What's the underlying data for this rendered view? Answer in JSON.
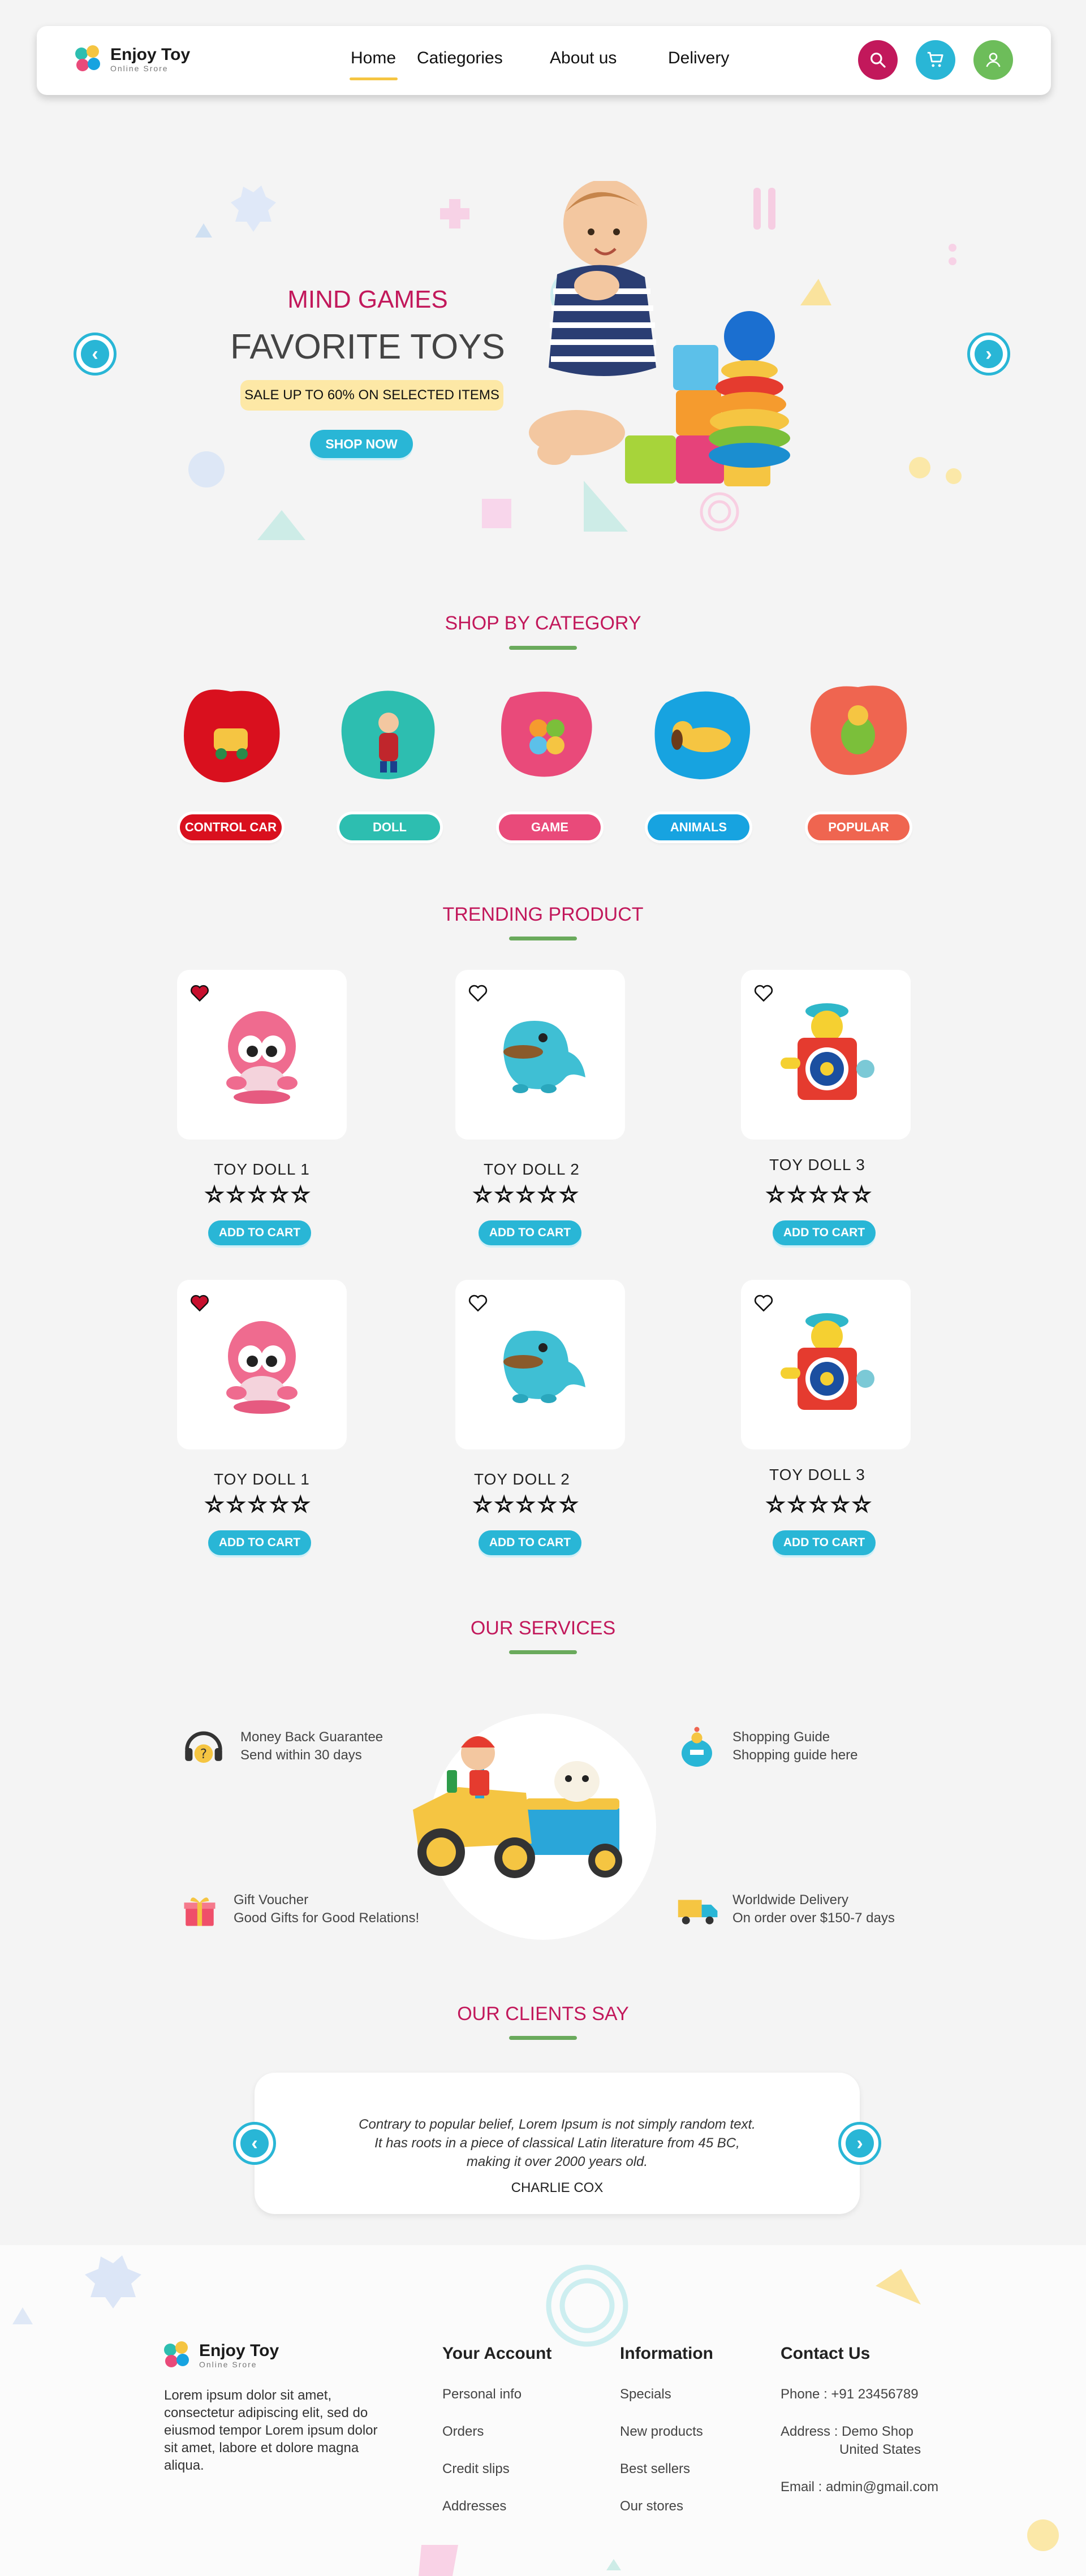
{
  "brand": {
    "name": "Enjoy Toy",
    "tagline": "Online Srore"
  },
  "nav": {
    "items": [
      "Home",
      "Catiegories",
      "About us",
      "Delivery"
    ],
    "active": "Home"
  },
  "hero": {
    "subtitle": "MIND GAMES",
    "title": "FAVORITE TOYS",
    "sale": "SALE UP TO 60% ON SELECTED ITEMS",
    "button": "SHOP NOW"
  },
  "categories": {
    "title": "SHOP BY CATEGORY",
    "items": [
      {
        "label": "CONTROL CAR",
        "color": "#d9101e"
      },
      {
        "label": "DOLL",
        "color": "#2dbeb0"
      },
      {
        "label": "GAME",
        "color": "#e94a7a"
      },
      {
        "label": "ANIMALS",
        "color": "#17a3e0"
      },
      {
        "label": "POPULAR",
        "color": "#ef6550"
      }
    ]
  },
  "trending": {
    "title": "TRENDING PRODUCT",
    "products": [
      {
        "name": "TOY  DOLL 1",
        "rating": 0,
        "button": "ADD TO CART",
        "favorite": true
      },
      {
        "name": "TOY  DOLL 2",
        "rating": 0,
        "button": "ADD TO CART",
        "favorite": false
      },
      {
        "name": "TOY  DOLL 3",
        "rating": 0,
        "button": "ADD TO CART",
        "favorite": false
      },
      {
        "name": "TOY  DOLL 1",
        "rating": 0,
        "button": "ADD TO CART",
        "favorite": true
      },
      {
        "name": "TOY  DOLL 2",
        "rating": 0,
        "button": "ADD TO CART",
        "favorite": false
      },
      {
        "name": "TOY  DOLL 3",
        "rating": 0,
        "button": "ADD TO CART",
        "favorite": false
      }
    ]
  },
  "services": {
    "title": "OUR SERVICES",
    "items": [
      {
        "title": "Money Back Guarantee",
        "desc": "Send within 30 days",
        "icon": "headset-icon"
      },
      {
        "title": "Shopping Guide",
        "desc": "Shopping guide here",
        "icon": "shopping-guide-icon"
      },
      {
        "title": "Gift Voucher",
        "desc": "Good Gifts for Good Relations!",
        "icon": "gift-icon"
      },
      {
        "title": "Worldwide Delivery",
        "desc": "On order over $150-7 days",
        "icon": "delivery-truck-icon"
      }
    ]
  },
  "clients": {
    "title": "OUR CLIENTS SAY",
    "quote_lines": [
      "Contrary to popular belief, Lorem Ipsum is not simply random text.",
      "It has roots in a piece of classical Latin literature from 45 BC,",
      "making it over 2000 years old."
    ],
    "author": "CHARLIE COX"
  },
  "footer": {
    "about_lines": [
      "Lorem ipsum dolor sit amet,",
      "consectetur adipiscing elit, sed do",
      "eiusmod tempor Lorem ipsum dolor",
      "sit amet, labore et dolore magna",
      "aliqua."
    ],
    "account": {
      "title": "Your Account",
      "links": [
        "Personal info",
        "Orders",
        "Credit slips",
        "Addresses"
      ]
    },
    "information": {
      "title": "Information",
      "links": [
        "Specials",
        "New products",
        "Best sellers",
        "Our stores"
      ]
    },
    "contact": {
      "title": "Contact Us",
      "phone": "Phone :  +91 23456789",
      "address_1": "Address :  Demo Shop",
      "address_2": "United States",
      "email": "Email :  admin@gmail.com"
    }
  },
  "colors": {
    "accent": "#29b6d6",
    "title": "#c2185b",
    "underline": "#6aaa5c",
    "search": "#c2185b",
    "cart": "#29b6d6",
    "user": "#6dbd5a"
  }
}
